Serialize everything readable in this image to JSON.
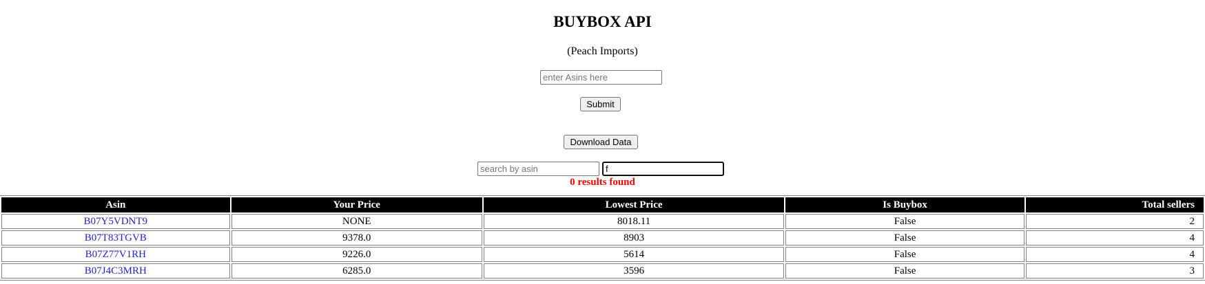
{
  "header": {
    "title": "BUYBOX API",
    "subtitle": "(Peach Imports)"
  },
  "asin_form": {
    "placeholder": "enter Asins here",
    "value": "",
    "submit_label": "Submit"
  },
  "download": {
    "label": "Download Data"
  },
  "filter": {
    "search_placeholder": "search by asin",
    "search_value": "",
    "filter_value": "f",
    "results_text": "0 results found"
  },
  "colors": {
    "results_text": "#ff0000",
    "header_bg": "#000000",
    "link": "#2323c8"
  },
  "table": {
    "columns": [
      "Asin",
      "Your Price",
      "Lowest Price",
      "Is Buybox",
      "Total sellers"
    ],
    "rows": [
      {
        "asin": "B07Y5VDNT9",
        "your_price": "NONE",
        "lowest_price": "8018.11",
        "is_buybox": "False",
        "total_sellers": "2"
      },
      {
        "asin": "B07T83TGVB",
        "your_price": "9378.0",
        "lowest_price": "8903",
        "is_buybox": "False",
        "total_sellers": "4"
      },
      {
        "asin": "B07Z77V1RH",
        "your_price": "9226.0",
        "lowest_price": "5614",
        "is_buybox": "False",
        "total_sellers": "4"
      },
      {
        "asin": "B07J4C3MRH",
        "your_price": "6285.0",
        "lowest_price": "3596",
        "is_buybox": "False",
        "total_sellers": "3"
      }
    ]
  }
}
